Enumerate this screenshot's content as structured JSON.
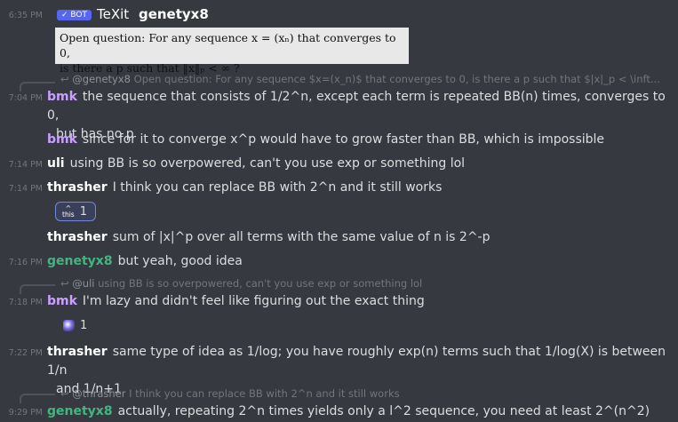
{
  "messages": [
    {
      "time": "6:35 PM",
      "bot_badge": "✓ BOT",
      "user": "TeXit",
      "mention": "genetyx8",
      "latex_line1": "Open question: For any sequence x = (xₙ) that converges to 0,",
      "latex_line2": "is there a p such that ‖x‖ₚ < ∞ ?"
    },
    {
      "reply_user": "@genetyx8",
      "reply_text": "Open question: For any sequence $x=(x_n)$ that converges to 0, is there a p such that $|x|_p < \\inft...",
      "time": "7:04 PM",
      "user": "bmk",
      "text_line1": "the sequence that consists of 1/2^n, except each term is repeated BB(n) times, converges to 0,",
      "text_line2": "but has no p"
    },
    {
      "user": "bmk",
      "text": "since for it to converge x^p would have to grow faster than BB, which is impossible"
    },
    {
      "time": "7:14 PM",
      "user": "uli",
      "text": "using BB is so overpowered, can't you use exp or something lol"
    },
    {
      "time": "7:14 PM",
      "user": "thrasher",
      "text": "I think you can replace BB with 2^n and it still works",
      "reaction_label": "this",
      "reaction_count": "1"
    },
    {
      "user": "thrasher",
      "text": "sum of |x|^p over all terms with the same value of n is 2^-p"
    },
    {
      "time": "7:16 PM",
      "user": "genetyx8",
      "text": "but yeah, good idea"
    },
    {
      "reply_user": "@uli",
      "reply_text": "using BB is so overpowered, can't you use exp or something lol",
      "time": "7:18 PM",
      "user": "bmk",
      "text": "I'm lazy and didn't feel like figuring out the exact thing",
      "reaction_count": "1"
    },
    {
      "time": "7:22 PM",
      "user": "thrasher",
      "text_line1": "same type of idea as 1/log; you have roughly exp(n) terms such that 1/log(X) is between 1/n",
      "text_line2": "and 1/n+1"
    },
    {
      "reply_user": "@thrasher",
      "reply_text": "I think you can replace BB with 2^n and it still works",
      "time": "9:29 PM",
      "user": "genetyx8",
      "text": "actually, repeating 2^n times yields only a l^2 sequence, you need at least 2^(n^2)"
    }
  ]
}
